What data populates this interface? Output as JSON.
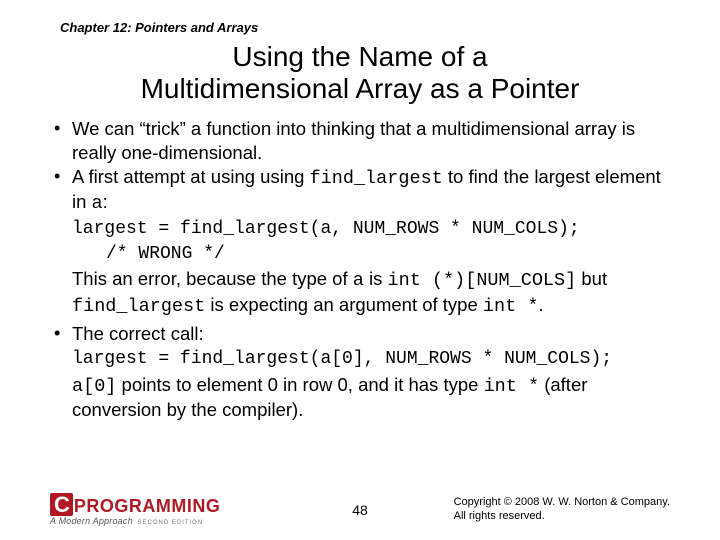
{
  "chapter": "Chapter 12: Pointers and Arrays",
  "title_line1": "Using the Name of a",
  "title_line2": "Multidimensional Array as a Pointer",
  "bullets": {
    "b1_pre": "We can “trick” a function into thinking that a multidimensional array is really one-dimensional.",
    "b2_pre": "A first attempt at using using ",
    "b2_code1": "find_largest",
    "b2_mid": " to find the largest element in ",
    "b2_code2": "a",
    "b2_post": ":",
    "b3_pre": "The correct call:"
  },
  "code1_line1": "largest = find_largest(a, NUM_ROWS * NUM_COLS);",
  "code1_line2": "/* WRONG */",
  "para1_pre": "This an error, because the type of ",
  "para1_c1": "a",
  "para1_m1": " is ",
  "para1_c2": "int (*)[NUM_COLS]",
  "para1_m2": " but ",
  "para1_c3": "find_largest",
  "para1_m3": " is expecting an argument of type ",
  "para1_c4": "int *",
  "para1_post": ".",
  "code2": "largest = find_largest(a[0], NUM_ROWS * NUM_COLS);",
  "para2_c1": "a[0]",
  "para2_m1": " points to element 0 in row 0, and it has type ",
  "para2_c2": "int *",
  "para2_m2": " (after conversion by the compiler).",
  "logo": {
    "c": "C",
    "prog": "PROGRAMMING",
    "sub": "A Modern Approach",
    "ed": "SECOND EDITION"
  },
  "page": "48",
  "copyright_l1": "Copyright © 2008 W. W. Norton & Company.",
  "copyright_l2": "All rights reserved."
}
